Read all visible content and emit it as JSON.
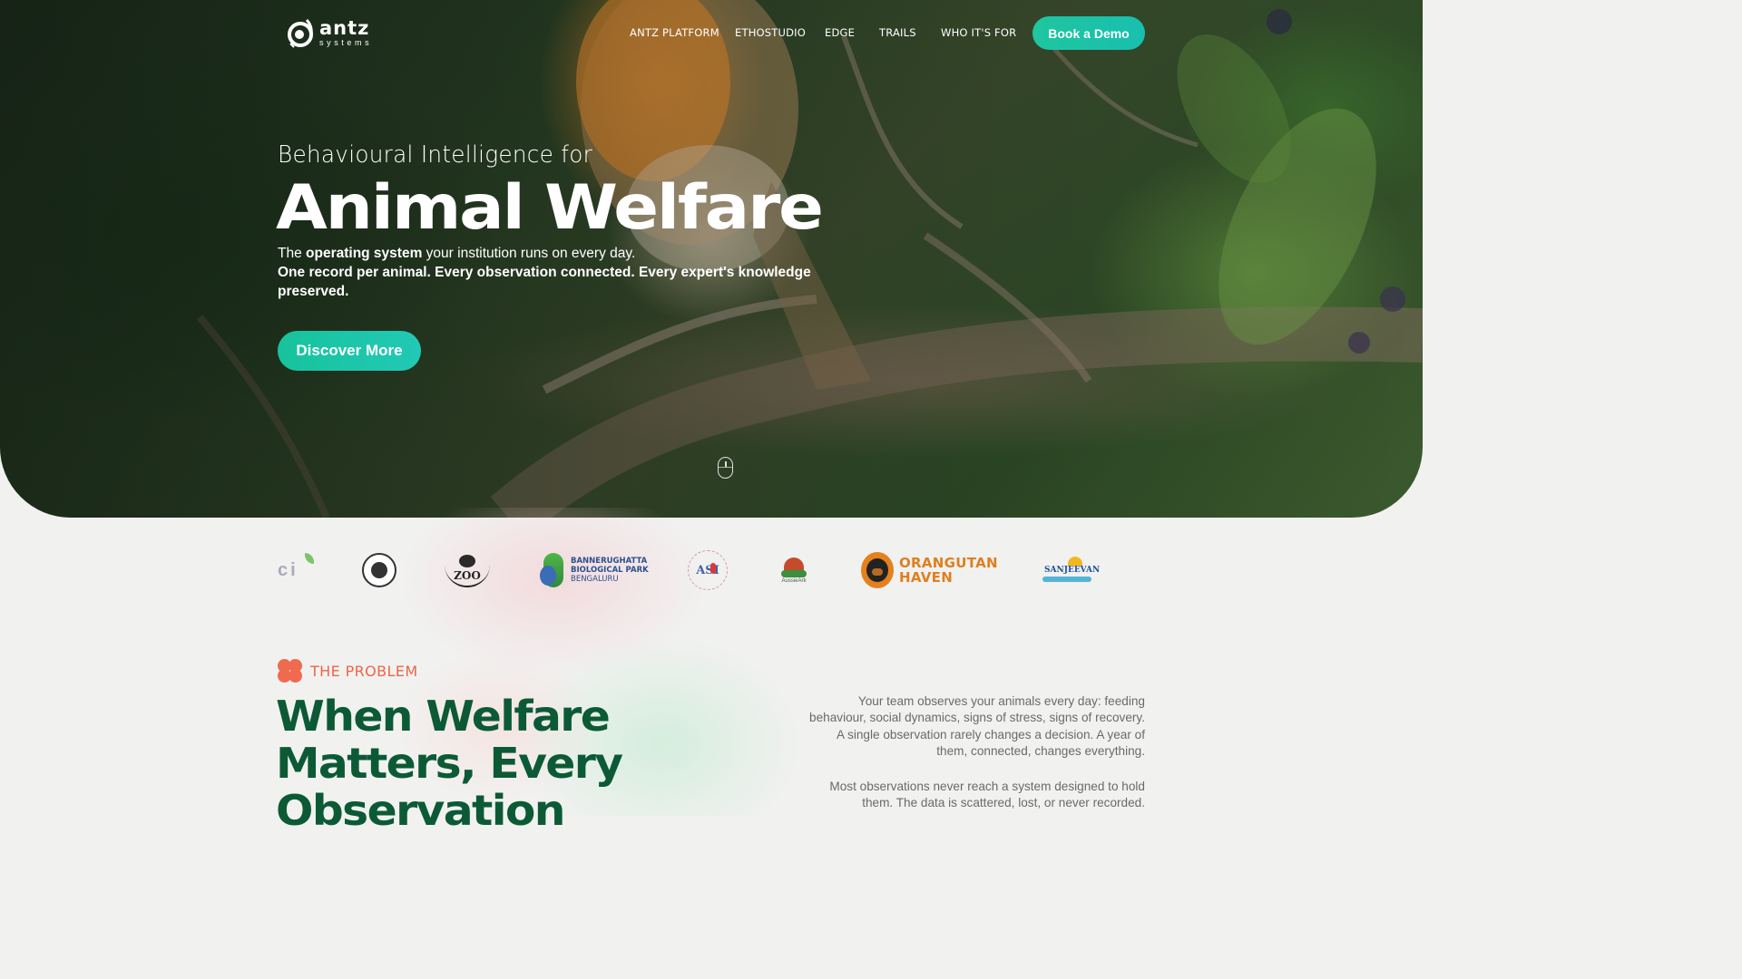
{
  "logo": {
    "word": "antz",
    "sub": "systems"
  },
  "nav": {
    "items": [
      "ANTZ PLATFORM",
      "ETHOSTUDIO",
      "EDGE",
      "TRAILS",
      "WHO IT'S FOR"
    ],
    "cta": "Book a Demo"
  },
  "hero": {
    "kicker": "Behavioural Intelligence for",
    "title": "Animal Welfare",
    "sub_pre": "The ",
    "sub_bold": "operating system",
    "sub_post": " your institution runs on every day.",
    "sub_line2": "One record per animal. Every observation connected. Every expert's knowledge preserved.",
    "cta": "Discover More"
  },
  "partners": {
    "ci": "ci",
    "zoo": "ZOO",
    "bbp_l1": "BANNERUGHATTA",
    "bbp_l2": "BIOLOGICAL PARK",
    "bbp_l3": "BENGALURU",
    "asi": "ASI",
    "aussie": "AussieArk",
    "oh_l1": "ORANGUTAN",
    "oh_l2": "HAVEN",
    "sanj": "SANJEEVAN"
  },
  "problem": {
    "label": "THE PROBLEM",
    "title": "When Welfare Matters, Every Observation",
    "p1": "Your team observes your animals every day: feeding behaviour, social dynamics, signs of stress, signs of recovery. A single observation rarely changes a decision. A year of them, connected, changes everything.",
    "p2": "Most observations never reach a system designed to hold them. The data is scattered, lost, or never recorded."
  },
  "colors": {
    "accent_teal": "#1fc6a0",
    "problem_orange": "#ee6549",
    "heading_green": "#0c5a35"
  }
}
